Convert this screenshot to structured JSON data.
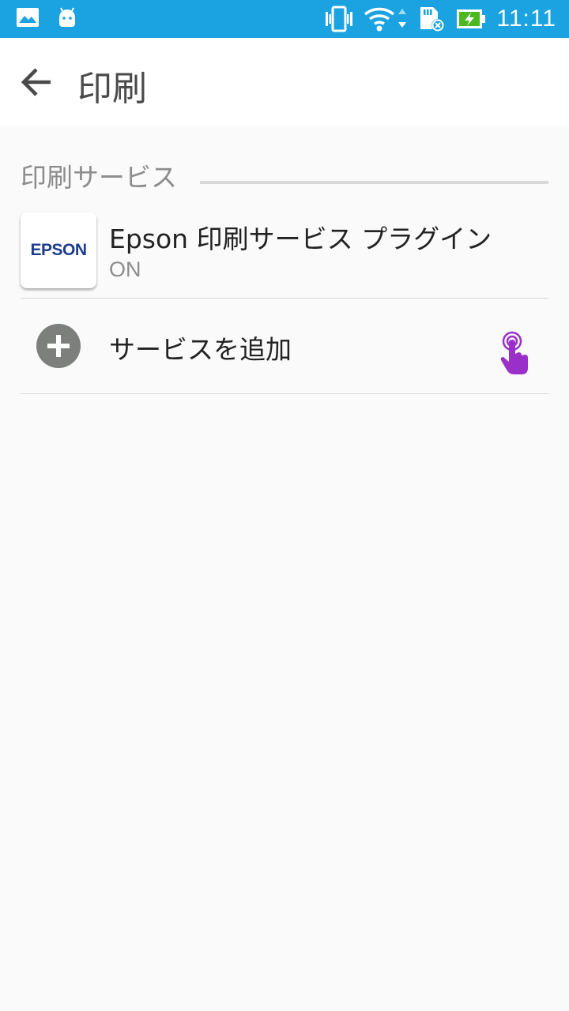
{
  "status_bar": {
    "time": "11:11",
    "icons": [
      "gallery-icon",
      "android-icon",
      "vibrate-icon",
      "wifi-icon",
      "sd-card-icon",
      "battery-charging-icon"
    ],
    "background_color": "#1aa3e0"
  },
  "app_bar": {
    "title": "印刷",
    "back_icon": "arrow-back-icon"
  },
  "section": {
    "header": "印刷サービス"
  },
  "services": [
    {
      "icon_text": "EPSON",
      "title": "Epson 印刷サービス プラグイン",
      "status": "ON",
      "brand_color": "#1b3c8f"
    }
  ],
  "add_service": {
    "label": "サービスを追加",
    "icon": "add-circle-icon"
  },
  "touch_indicator": {
    "icon": "pointer-hand-icon",
    "color": "#9b30c9"
  }
}
